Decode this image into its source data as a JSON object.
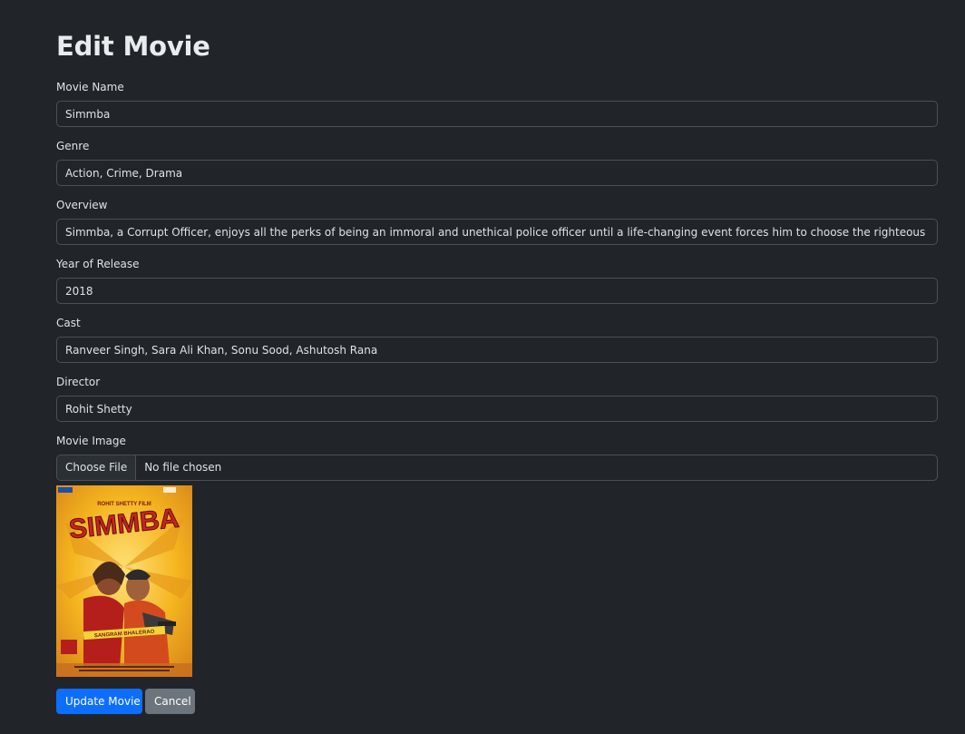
{
  "page": {
    "title": "Edit Movie"
  },
  "form": {
    "movie_name": {
      "label": "Movie Name",
      "value": "Simmba"
    },
    "genre": {
      "label": "Genre",
      "value": "Action, Crime, Drama"
    },
    "overview": {
      "label": "Overview",
      "value": "Simmba, a Corrupt Officer, enjoys all the perks of being an immoral and unethical police officer until a life-changing event forces him to choose the righteous path."
    },
    "year": {
      "label": "Year of Release",
      "value": "2018"
    },
    "cast": {
      "label": "Cast",
      "value": "Ranveer Singh, Sara Ali Khan, Sonu Sood, Ashutosh Rana"
    },
    "director": {
      "label": "Director",
      "value": "Rohit Shetty"
    },
    "image": {
      "label": "Movie Image",
      "button_label": "Choose File",
      "status": "No file chosen"
    }
  },
  "poster": {
    "title_text": "SIMMBA",
    "banner_text": "SANGRAM BHALERAO",
    "credit_text": "ROHIT SHETTY FILM"
  },
  "actions": {
    "update_label": "Update Movie",
    "cancel_label": "Cancel"
  },
  "colors": {
    "background": "#212529",
    "primary": "#0d6efd",
    "secondary": "#6c757d",
    "poster_yellow": "#f5b51f",
    "poster_red": "#c8231f"
  }
}
